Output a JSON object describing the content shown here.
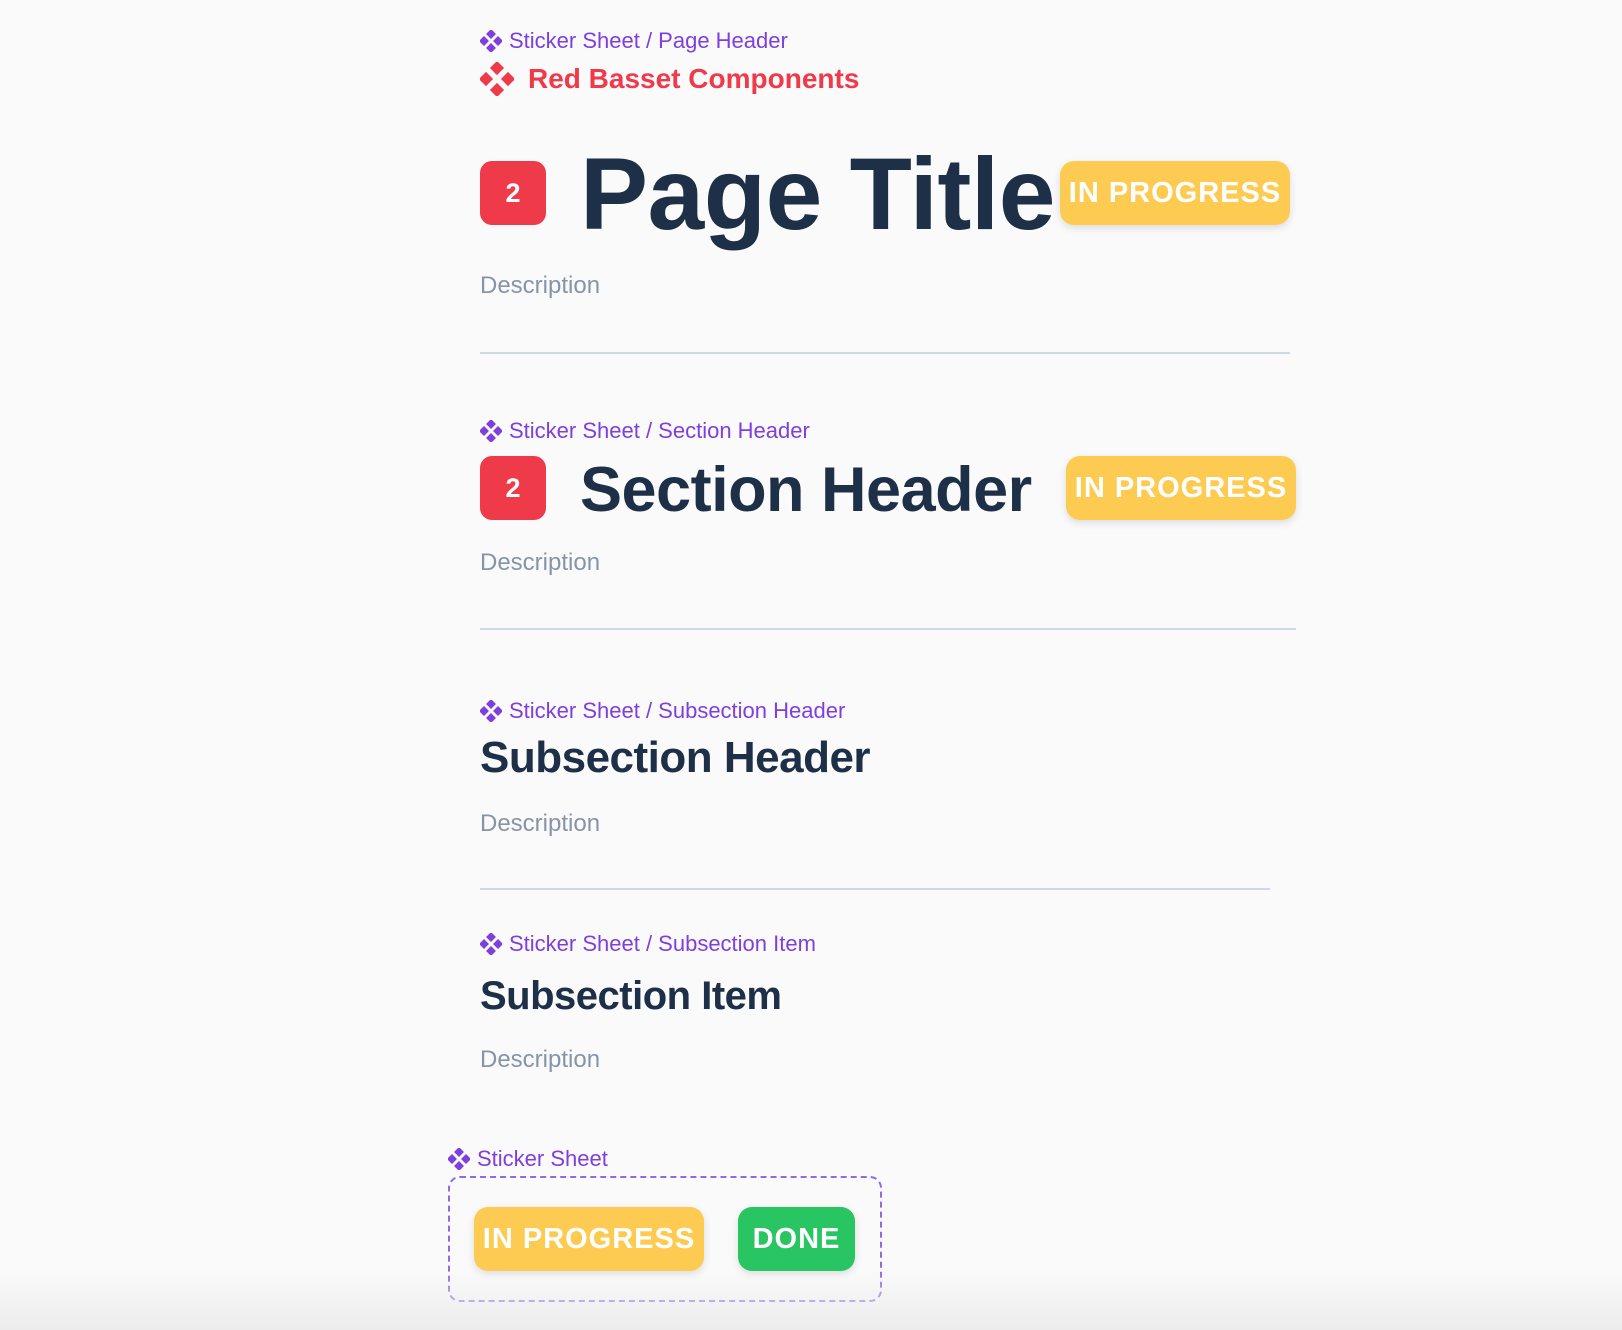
{
  "colors": {
    "component_purple": "#7e3fde",
    "brand_red": "#ef3a4a",
    "title_navy": "#1e2f48",
    "description_gray": "#8794a8",
    "divider": "#cfd8e6",
    "in_progress_yellow": "#fecb52",
    "done_green": "#28c562",
    "dashed_frame": "#8c6be8"
  },
  "page_header": {
    "component_path": "Sticker Sheet / Page Header",
    "brand_name": "Red Basset Components",
    "badge_number": "2",
    "title": "Page Title",
    "status": "IN PROGRESS",
    "description": "Description"
  },
  "section_header": {
    "component_path": "Sticker Sheet / Section Header",
    "badge_number": "2",
    "title": "Section Header",
    "status": "IN PROGRESS",
    "description": "Description"
  },
  "subsection_header": {
    "component_path": "Sticker Sheet / Subsection Header",
    "title": "Subsection Header",
    "description": "Description"
  },
  "subsection_item": {
    "component_path": "Sticker Sheet / Subsection Item",
    "title": "Subsection Item",
    "description": "Description"
  },
  "sticker_sheet": {
    "component_path": "Sticker Sheet",
    "stickers": [
      {
        "label": "IN PROGRESS",
        "status": "in-progress"
      },
      {
        "label": "DONE",
        "status": "done"
      }
    ]
  }
}
